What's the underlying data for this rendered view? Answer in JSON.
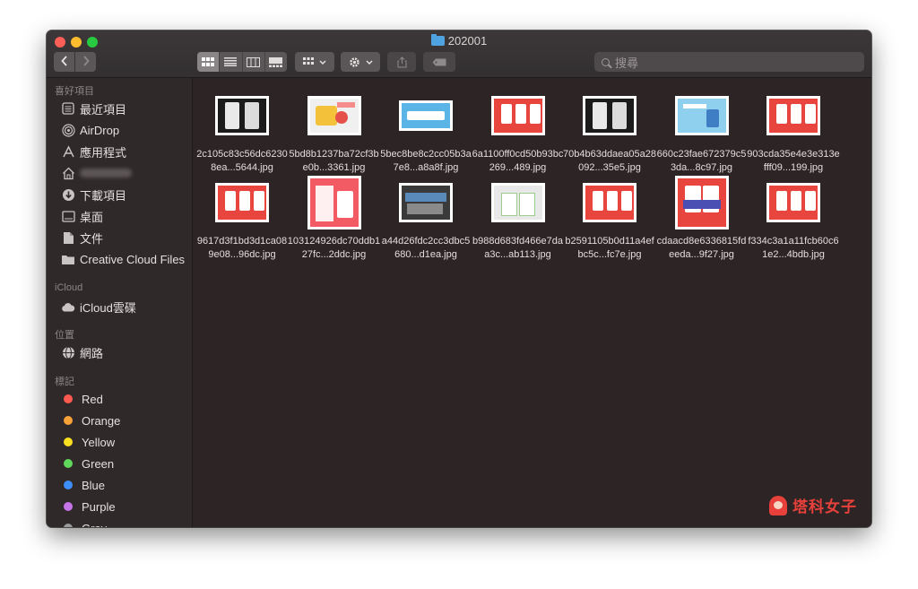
{
  "window": {
    "title": "202001"
  },
  "toolbar": {
    "back_icon": "chevron-left-icon",
    "forward_icon": "chevron-right-icon",
    "view_modes": [
      "icon-view-icon",
      "list-view-icon",
      "column-view-icon",
      "gallery-view-icon"
    ],
    "active_view": "icon-view-icon",
    "search_placeholder": "搜尋"
  },
  "sidebar": {
    "favorites_header": "喜好項目",
    "favorites": [
      {
        "label": "最近項目",
        "icon": "recents-icon"
      },
      {
        "label": "AirDrop",
        "icon": "airdrop-icon"
      },
      {
        "label": "應用程式",
        "icon": "applications-icon"
      },
      {
        "label": "",
        "icon": "home-icon",
        "blurred": true
      },
      {
        "label": "下載項目",
        "icon": "downloads-icon"
      },
      {
        "label": "桌面",
        "icon": "desktop-icon"
      },
      {
        "label": "文件",
        "icon": "documents-icon"
      },
      {
        "label": "Creative Cloud Files",
        "icon": "folder-icon"
      }
    ],
    "icloud_header": "iCloud",
    "icloud": [
      {
        "label": "iCloud雲碟",
        "icon": "cloud-icon"
      }
    ],
    "locations_header": "位置",
    "locations": [
      {
        "label": "網路",
        "icon": "network-icon"
      }
    ],
    "tags_header": "標記",
    "tags": [
      {
        "label": "Red",
        "color": "#ff5a52"
      },
      {
        "label": "Orange",
        "color": "#f7a239"
      },
      {
        "label": "Yellow",
        "color": "#fbe022"
      },
      {
        "label": "Green",
        "color": "#5fd85c"
      },
      {
        "label": "Blue",
        "color": "#3d8ef7"
      },
      {
        "label": "Purple",
        "color": "#c575e8"
      },
      {
        "label": "Gray",
        "color": "#9a9a9a"
      }
    ]
  },
  "files": [
    {
      "name": "2c105c83c56dc62308ea...5644.jpg",
      "theme": "black"
    },
    {
      "name": "5bd8b1237ba72cf3be0b...3361.jpg",
      "theme": "yellow"
    },
    {
      "name": "5bec8be8c2cc05b3a7e8...a8a8f.jpg",
      "theme": "blue"
    },
    {
      "name": "6a1100ff0cd50b93bc269...489.jpg",
      "theme": "red"
    },
    {
      "name": "70b4b63ddaea05a28092...35e5.jpg",
      "theme": "black"
    },
    {
      "name": "660c23fae672379c53da...8c97.jpg",
      "theme": "lightblue"
    },
    {
      "name": "903cda35e4e3e313efff09...199.jpg",
      "theme": "red"
    },
    {
      "name": "9617d3f1bd3d1ca089e08...96dc.jpg",
      "theme": "red"
    },
    {
      "name": "103124926dc70ddb127fc...2ddc.jpg",
      "theme": "redtall"
    },
    {
      "name": "a44d26fdc2cc3dbc5680...d1ea.jpg",
      "theme": "dark"
    },
    {
      "name": "b988d683fd466e7daa3c...ab113.jpg",
      "theme": "gray"
    },
    {
      "name": "b2591105b0d11a4efbc5c...fc7e.jpg",
      "theme": "red"
    },
    {
      "name": "cdaacd8e6336815fdeeda...9f27.jpg",
      "theme": "redsq"
    },
    {
      "name": "f334c3a1a11fcb60c61e2...4bdb.jpg",
      "theme": "red"
    }
  ],
  "watermark": {
    "text": "塔科女子"
  },
  "colors": {
    "window_bg": "#2d2425",
    "sidebar_bg": "#2f2929",
    "accent_folder": "#4fa3e0"
  }
}
